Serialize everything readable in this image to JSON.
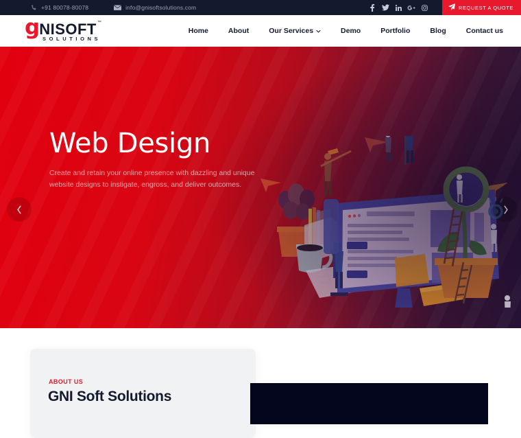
{
  "topbar": {
    "phone_icon": "phone-icon",
    "phone": "+91 80078-80078",
    "mail_icon": "envelope-icon",
    "email": "info@gnisoftsolutions.com",
    "socials": [
      {
        "name": "facebook-icon",
        "label": "f"
      },
      {
        "name": "twitter-icon",
        "label": "t"
      },
      {
        "name": "linkedin-icon",
        "label": "in"
      },
      {
        "name": "google-plus-icon",
        "label": "G+"
      },
      {
        "name": "instagram-icon",
        "label": "ig"
      }
    ],
    "quote_button": "REQUEST A QUOTE",
    "quote_icon": "paper-plane-icon",
    "bg_color": "#141a2e",
    "quote_color": "#e8192c"
  },
  "navbar": {
    "logo": {
      "mark": "g",
      "word": "NISOFT",
      "trademark": "™",
      "subtitle": "SOLUTIONS",
      "mark_color": "#e8192c",
      "word_color": "#141a2e"
    },
    "menu": [
      {
        "label": "Home",
        "has_dropdown": false
      },
      {
        "label": "About",
        "has_dropdown": false
      },
      {
        "label": "Our Services",
        "has_dropdown": true
      },
      {
        "label": "Demo",
        "has_dropdown": false
      },
      {
        "label": "Portfolio",
        "has_dropdown": false
      },
      {
        "label": "Blog",
        "has_dropdown": false
      },
      {
        "label": "Contact us",
        "has_dropdown": false
      }
    ]
  },
  "hero": {
    "title": "Web Design",
    "subtitle": "Create and retain your online presence with dazzling and unique website designs to instigate, engross, and deliver outcomes.",
    "prev_icon": "chevron-left-icon",
    "next_icon": "chevron-right-icon",
    "gradient_start": "#e2000f",
    "gradient_end": "#281437",
    "illustration": "web-design-workspace-illustration"
  },
  "about": {
    "kicker": "ABOUT US",
    "title": "GNI Soft Solutions",
    "card_bg": "#f1f2f3",
    "dark_panel_bg": "#04061d"
  }
}
